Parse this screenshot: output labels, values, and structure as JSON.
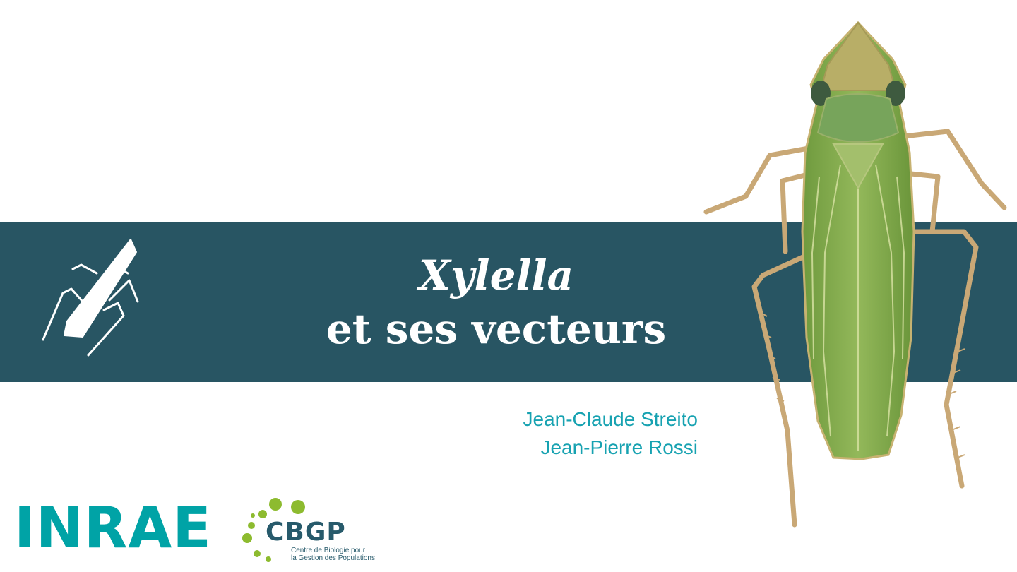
{
  "slide": {
    "title_line1": "Xylella",
    "title_line2": "et ses vecteurs",
    "authors": [
      "Jean-Claude Streito",
      "Jean-Pierre Rossi"
    ]
  },
  "logos": {
    "inrae": "INRAE",
    "cbgp": "CBGP",
    "cbgp_tagline": [
      "Centre de Biologie pour",
      "la Gestion des Populations"
    ]
  },
  "colors": {
    "band": "#285563",
    "author_text": "#17a2b1",
    "inrae": "#00a3a6",
    "cbgp_text": "#275a6b",
    "cbgp_dots": "#8dbb2f",
    "insect_green": "#7ea64a"
  },
  "icons": [
    "leafhopper-silhouette-icon",
    "leafhopper-photo",
    "inrae-logo",
    "cbgp-logo"
  ]
}
